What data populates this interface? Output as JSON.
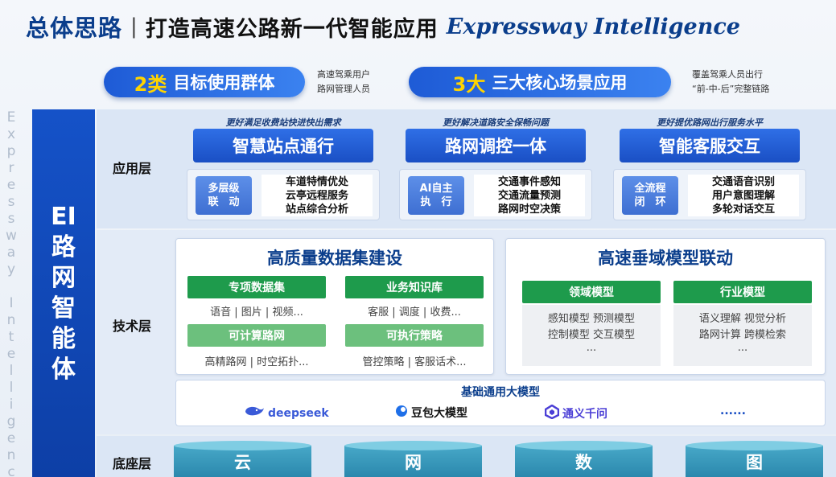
{
  "title": {
    "main": "总体思路",
    "separator": "|",
    "sub": "打造高速公路新一代智能应用",
    "en": "Expressway Intelligence"
  },
  "banners": [
    {
      "num": "2类",
      "text": "目标使用群体",
      "note_lines": [
        "高速驾乘用户",
        "路网管理人员"
      ]
    },
    {
      "num": "3大",
      "text": "三大核心场景应用",
      "note_lines": [
        "覆盖驾乘人员出行",
        "“前-中-后”完整链路"
      ]
    }
  ],
  "side_vertical_en": "Expressway Intelligence",
  "side_title_chars": [
    "EI",
    "路",
    "网",
    "智",
    "能",
    "体"
  ],
  "layers": {
    "app": "应用层",
    "tech": "技术层",
    "base": "底座层"
  },
  "apps": [
    {
      "caption": "更好满足收费站快进快出需求",
      "title": "智慧站点通行",
      "tag_lines": [
        "多层级",
        "联　动"
      ],
      "items": [
        "车道特情优处",
        "云亭远程服务",
        "站点综合分析"
      ]
    },
    {
      "caption": "更好解决道路安全保畅问题",
      "title": "路网调控一体",
      "tag_lines": [
        "AI自主",
        "执　行"
      ],
      "items": [
        "交通事件感知",
        "交通流量预测",
        "路网时空决策"
      ]
    },
    {
      "caption": "更好提优路网出行服务水平",
      "title": "智能客服交互",
      "tag_lines": [
        "全流程",
        "闭　环"
      ],
      "items": [
        "交通语音识别",
        "用户意图理解",
        "多轮对话交互"
      ]
    }
  ],
  "data_panel": {
    "title": "高质量数据集建设",
    "tags": [
      {
        "label": "专项数据集",
        "desc": "语音 | 图片 | 视频..."
      },
      {
        "label": "业务知识库",
        "desc": "客服 | 调度 | 收费..."
      },
      {
        "label": "可计算路网",
        "desc": "高精路网 | 时空拓扑..."
      },
      {
        "label": "可执行策略",
        "desc": "管控策略 | 客服话术..."
      }
    ]
  },
  "model_panel": {
    "title": "高速垂域模型联动",
    "groups": [
      {
        "label": "领域模型",
        "lines": [
          "感知模型  预测模型",
          "控制模型  交互模型",
          "..."
        ]
      },
      {
        "label": "行业模型",
        "lines": [
          "语义理解  视觉分析",
          "路网计算  跨模检索",
          "..."
        ]
      }
    ]
  },
  "base_model": {
    "title": "基础通用大模型",
    "logos": [
      "deepseek",
      "豆包大模型",
      "通义千问",
      "......"
    ]
  },
  "foundation": [
    "云",
    "网",
    "数",
    "图"
  ],
  "colors": {
    "primary_blue": "#1a4fc4",
    "accent_yellow": "#ffd400",
    "green": "#1e9b4c",
    "light_green": "#6cc07d",
    "teal": "#2b88ad"
  }
}
